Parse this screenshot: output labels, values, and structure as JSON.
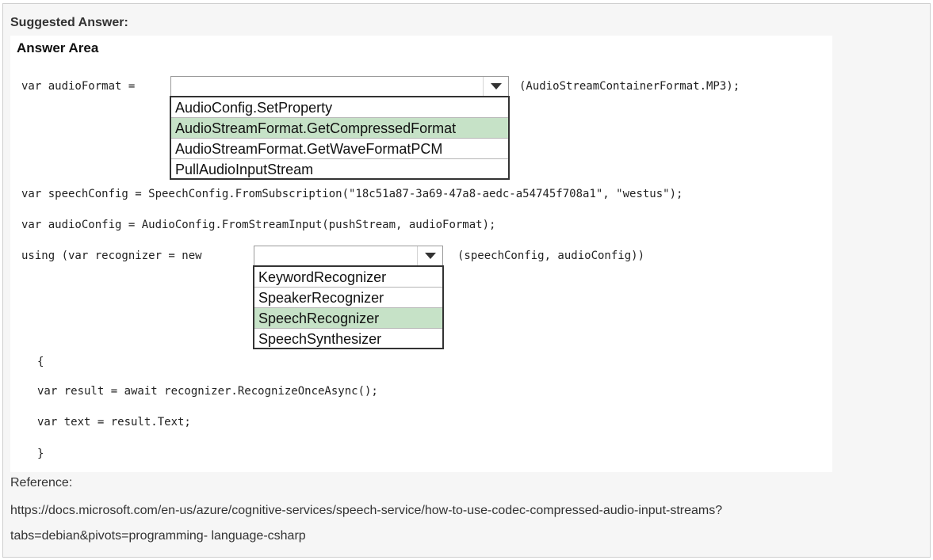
{
  "heading": "Suggested Answer:",
  "answer_area": {
    "title": "Answer Area",
    "lines": {
      "audio_format_prefix": "var audioFormat =",
      "audio_format_suffix": "(AudioStreamContainerFormat.MP3);",
      "speech_config": "var speechConfig = SpeechConfig.FromSubscription(\"18c51a87-3a69-47a8-aedc-a54745f708a1\", \"westus\");",
      "audio_config": "var audioConfig = AudioConfig.FromStreamInput(pushStream, audioFormat);",
      "using_prefix": "using (var recognizer = new",
      "using_suffix": "(speechConfig, audioConfig))",
      "open_brace": "{",
      "result_line": "var result = await recognizer.RecognizeOnceAsync();",
      "text_line": "var text = result.Text;",
      "close_brace": "}"
    },
    "dropdown1": {
      "options": [
        "AudioConfig.SetProperty",
        "AudioStreamFormat.GetCompressedFormat",
        "AudioStreamFormat.GetWaveFormatPCM",
        "PullAudioInputStream"
      ],
      "selected": "AudioStreamFormat.GetCompressedFormat"
    },
    "dropdown2": {
      "options": [
        "KeywordRecognizer",
        "SpeakerRecognizer",
        "SpeechRecognizer",
        "SpeechSynthesizer"
      ],
      "selected": "SpeechRecognizer"
    }
  },
  "reference": {
    "label": "Reference:",
    "url_line1": "https://docs.microsoft.com/en-us/azure/cognitive-services/speech-service/how-to-use-codec-compressed-audio-input-streams?",
    "url_line2": "tabs=debian&pivots=programming- language-csharp"
  },
  "colors": {
    "selected_option": "#c6e2c7",
    "panel_background": "#f6f6f6"
  },
  "icons": {
    "dropdown_arrow": "triangle-down-icon"
  }
}
